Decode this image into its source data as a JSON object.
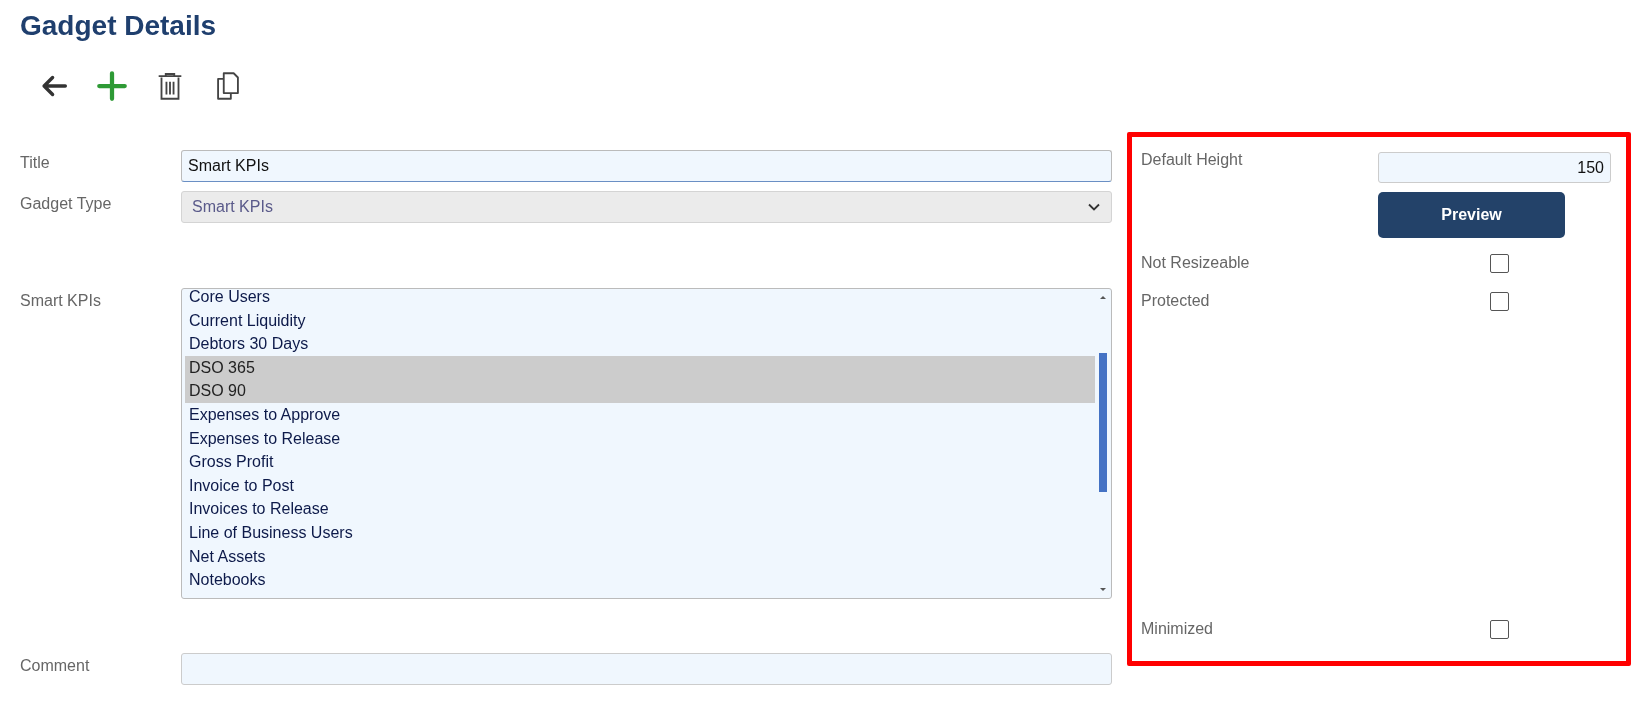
{
  "page_title": "Gadget Details",
  "toolbar": [
    {
      "kind": "back"
    },
    {
      "kind": "add"
    },
    {
      "kind": "delete"
    },
    {
      "kind": "copy"
    }
  ],
  "form": {
    "title": {
      "label": "Title",
      "value": "Smart KPIs"
    },
    "gadget_type": {
      "label": "Gadget Type",
      "value": "Smart KPIs",
      "disabled": true
    },
    "smart_kpis": {
      "label": "Smart KPIs",
      "items": [
        {
          "label": "Core Users",
          "selected": false
        },
        {
          "label": "Current Liquidity",
          "selected": false
        },
        {
          "label": "Debtors 30 Days",
          "selected": false
        },
        {
          "label": "DSO 365",
          "selected": true
        },
        {
          "label": "DSO 90",
          "selected": true
        },
        {
          "label": "Expenses to Approve",
          "selected": false
        },
        {
          "label": "Expenses to Release",
          "selected": false
        },
        {
          "label": "Gross Profit",
          "selected": false
        },
        {
          "label": "Invoice to Post",
          "selected": false
        },
        {
          "label": "Invoices to Release",
          "selected": false
        },
        {
          "label": "Line of Business Users",
          "selected": false
        },
        {
          "label": "Net Assets",
          "selected": false
        },
        {
          "label": "Notebooks",
          "selected": false
        }
      ]
    },
    "comment": {
      "label": "Comment"
    }
  },
  "settings": {
    "default_height": {
      "label": "Default Height",
      "value": "150"
    },
    "preview_button": "Preview",
    "options": [
      {
        "label": "Not Resizeable",
        "checked": false
      },
      {
        "label": "Protected",
        "checked": false
      },
      {
        "label": "Minimized",
        "checked": false
      }
    ]
  }
}
